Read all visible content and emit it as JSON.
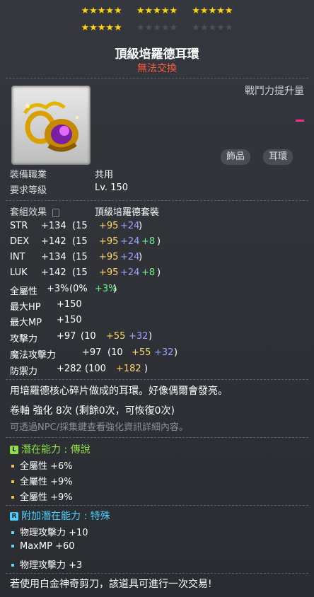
{
  "stars": {
    "row1": [
      5,
      5,
      5
    ],
    "row2_on": 5,
    "row2_off_groups": 2
  },
  "item": {
    "name": "頂級培羅德耳環",
    "trade": "無法交換",
    "combat_label": "戰鬥力提升量",
    "tags": [
      "飾品",
      "耳環"
    ],
    "job_label": "裝備職業",
    "job_value": "共用",
    "level_label": "要求等級",
    "level_value": "Lv. 150",
    "set_label": "套組效果",
    "set_value": "頂級培羅德套裝",
    "stats": [
      {
        "name": "STR",
        "total": "+134",
        "base": "(15",
        "a": "+95",
        "b": "+24",
        "c": "",
        "end": ")"
      },
      {
        "name": "DEX",
        "total": "+142",
        "base": "(15",
        "a": "+95",
        "b": "+24",
        "c": "+8",
        "end": ")"
      },
      {
        "name": "INT",
        "total": "+134",
        "base": "(15",
        "a": "+95",
        "b": "+24",
        "c": "",
        "end": ")"
      },
      {
        "name": "LUK",
        "total": "+142",
        "base": "(15",
        "a": "+95",
        "b": "+24",
        "c": "+8",
        "end": ")"
      }
    ],
    "allstat": {
      "name": "全屬性",
      "total": "+3%",
      "base": "(0%",
      "c": "+3%",
      "end": ")"
    },
    "hp": {
      "name": "最大HP",
      "total": "+150"
    },
    "mp": {
      "name": "最大MP",
      "total": "+150"
    },
    "atk": {
      "name": "攻擊力",
      "total": "+97",
      "base": "(10",
      "a": "+55",
      "b": "+32",
      "end": ")"
    },
    "matk": {
      "name": "魔法攻擊力",
      "total": "+97",
      "base": "(10",
      "a": "+55",
      "b": "+32",
      "end": ")"
    },
    "def": {
      "name": "防禦力",
      "total": "+282",
      "base": "(100",
      "a": "+182",
      "end": ")"
    },
    "desc": "用培羅德核心碎片做成的耳環。好像偶爾會發亮。",
    "scroll": "卷軸 強化 8次 (剩餘0次，可恢復0次)",
    "hint": "可透過NPC/採集鍵查看強化資訊詳細內容。",
    "potential_title": "潛在能力 : 傳說",
    "potential": [
      "全屬性 +6%",
      "全屬性 +9%",
      "全屬性 +9%"
    ],
    "bonus_title": "附加潛在能力 : 特殊",
    "bonus": [
      "物理攻擊力 +10",
      "MaxMP +60",
      "物理攻擊力 +3"
    ],
    "footer": "若使用白金神奇剪刀，該道具可進行一次交易!"
  },
  "colors": {
    "gold": "#ffd86a",
    "blue": "#9aa3ff",
    "green": "#69f08a",
    "trade": "#ff5a3c",
    "potential": "#8fe04a",
    "bonus": "#4dd0ff"
  }
}
